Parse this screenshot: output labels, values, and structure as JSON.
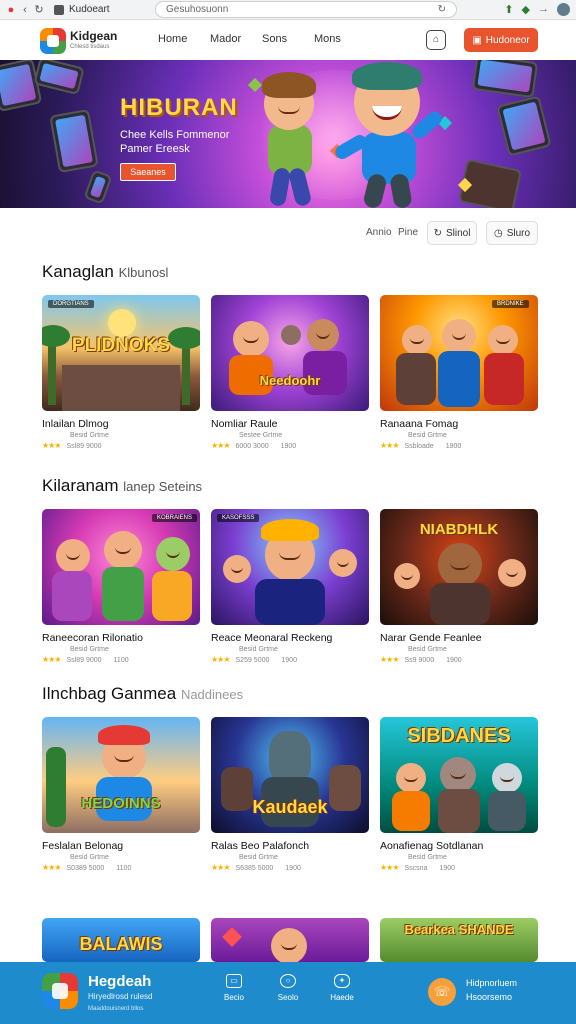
{
  "browser": {
    "tab_title": "Kudoeart",
    "url": "Gesuhosuonn",
    "avatar_icon": "profile-avatar-icon"
  },
  "nav": {
    "brand": "Kidgean",
    "brand_sub": "Chlesd tisdaus",
    "links": [
      "Home",
      "Mador",
      "Sons",
      "Mons"
    ],
    "cta": "Hudoneor"
  },
  "hero": {
    "title": "HIBURAN",
    "subtitle": "Chee Kells Fommenor Pamer Ereesk",
    "button": "Saeanes"
  },
  "filters": {
    "label_a": "Annio",
    "label_b": "Pine",
    "btn_a": "Slinol",
    "btn_b": "Sluro"
  },
  "sections": [
    {
      "title": "Kanaglan",
      "title_extra": "Klbunosl",
      "cards": [
        {
          "tag": "DORGTIANS",
          "thumb_word": "PLIDNOKS",
          "title": "Inlailan Dlmog",
          "meta": "Besid Grtme",
          "stat_a": "Ssl89 9000",
          "stat_b": ""
        },
        {
          "tag": "",
          "thumb_word": "Needoohr",
          "title": "Nomliar  Raule",
          "meta": "Sestee Grtme",
          "stat_a": "6000 3000",
          "stat_b": "1900"
        },
        {
          "tag": "BRDNIKE",
          "thumb_word": "",
          "title": "Ranaana Fomag",
          "meta": "Besid Grtme",
          "stat_a": "Ssbloade",
          "stat_b": "1900"
        }
      ]
    },
    {
      "title": "Kilaranam",
      "title_extra": "lanep Seteins",
      "cards": [
        {
          "tag": "KOBRAIENS",
          "thumb_word": "",
          "title": "Raneecoran Rilonatio",
          "meta": "Besid Grtme",
          "stat_a": "Ssl89 9000",
          "stat_b": "1100"
        },
        {
          "tag": "KASOFSSS",
          "thumb_word": "",
          "title": "Reace Meonaral  Reckeng",
          "meta": "Besid Grtme",
          "stat_a": "S259 5000",
          "stat_b": "1900"
        },
        {
          "tag": "",
          "thumb_word": "NIABDHLK",
          "title": "Narar Gende Feanlee",
          "meta": "Besid Grtme",
          "stat_a": "Ss9 9000",
          "stat_b": "1900"
        }
      ]
    },
    {
      "title": "Ilnchbag Ganmea",
      "title_extra": "Naddinees",
      "cards": [
        {
          "tag": "",
          "thumb_word": "HEDOINNS",
          "title": "Feslalan Belonag",
          "meta": "Besid Grtme",
          "stat_a": "S0389 5000",
          "stat_b": "1100"
        },
        {
          "tag": "",
          "thumb_word": "Kaudaek",
          "title": "Ralas Beo Palafonch",
          "meta": "Besid Grtme",
          "stat_a": "S6385 5000",
          "stat_b": "1900"
        },
        {
          "tag": "",
          "thumb_word": "SIBDANES",
          "title": "Aonafienag Sotdlanan",
          "meta": "Besid Grtme",
          "stat_a": "Sscsna",
          "stat_b": "1900"
        }
      ]
    }
  ],
  "peek_cards": [
    {
      "thumb_word": "BALAWIS"
    },
    {
      "thumb_word": ""
    },
    {
      "thumb_word": "Bearkea SHANDE"
    }
  ],
  "bottom": {
    "brand": "Hegdeah",
    "tagline": "Hiryedlrosd rulesd",
    "sub": "Maaddouisnerd bllos",
    "nav": [
      {
        "label": "Becio",
        "icon": "grid-icon"
      },
      {
        "label": "Seolo",
        "icon": "search-icon"
      },
      {
        "label": "Haede",
        "icon": "controller-icon"
      }
    ],
    "contact_line1": "Hidpnorluem",
    "contact_line2": "Hsoorsemo"
  }
}
